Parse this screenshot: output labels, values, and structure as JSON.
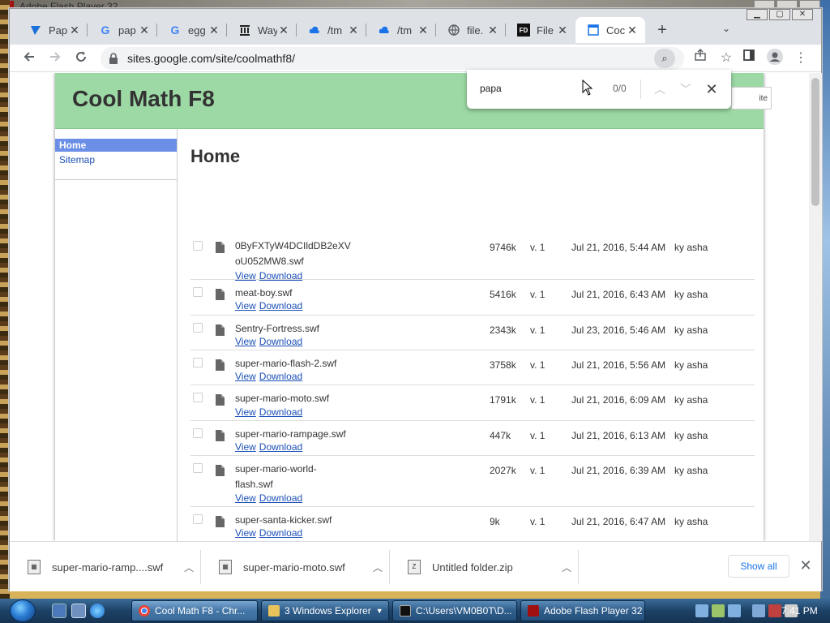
{
  "desktop": {
    "flash_title": "Adobe Flash Player 32"
  },
  "tabs": [
    {
      "label": "Pap",
      "icon": "puffin-icon",
      "active": false
    },
    {
      "label": "pap",
      "icon": "google-icon",
      "active": false
    },
    {
      "label": "egg",
      "icon": "google-icon",
      "active": false
    },
    {
      "label": "Way",
      "icon": "archive-icon",
      "active": false
    },
    {
      "label": "/tm",
      "icon": "cloud-icon",
      "active": false
    },
    {
      "label": "/tm",
      "icon": "cloud-icon",
      "active": false
    },
    {
      "label": "file.",
      "icon": "globe-icon",
      "active": false
    },
    {
      "label": "File",
      "icon": "fd-icon",
      "active": false
    },
    {
      "label": "Coc",
      "icon": "page-icon",
      "active": true
    }
  ],
  "toolbar": {
    "url": "sites.google.com/site/coolmathf8/"
  },
  "findbar": {
    "query": "papa",
    "count": "0/0"
  },
  "site": {
    "title": "Cool Math F8",
    "edit_label": "ite",
    "nav": {
      "home": "Home",
      "sitemap": "Sitemap"
    },
    "page_title": "Home",
    "view_label": "View",
    "download_label": "Download",
    "files": [
      {
        "name": "0ByFXTyW4DCIldDB2eXV oU052MW8.swf",
        "size": "9746k",
        "version": "v. 1",
        "date": "Jul 21, 2016, 5:44 AM",
        "user": "ky asha"
      },
      {
        "name": "meat-boy.swf",
        "size": "5416k",
        "version": "v. 1",
        "date": "Jul 21, 2016, 6:43 AM",
        "user": "ky asha"
      },
      {
        "name": "Sentry-Fortress.swf",
        "size": "2343k",
        "version": "v. 1",
        "date": "Jul 23, 2016, 5:46 AM",
        "user": "ky asha"
      },
      {
        "name": "super-mario-flash-2.swf",
        "size": "3758k",
        "version": "v. 1",
        "date": "Jul 21, 2016, 5:56 AM",
        "user": "ky asha"
      },
      {
        "name": "super-mario-moto.swf",
        "size": "1791k",
        "version": "v. 1",
        "date": "Jul 21, 2016, 6:09 AM",
        "user": "ky asha"
      },
      {
        "name": "super-mario-rampage.swf",
        "size": "447k",
        "version": "v. 1",
        "date": "Jul 21, 2016, 6:13 AM",
        "user": "ky asha"
      },
      {
        "name": "super-mario-world- flash.swf",
        "size": "2027k",
        "version": "v. 1",
        "date": "Jul 21, 2016, 6:39 AM",
        "user": "ky asha"
      },
      {
        "name": "super-santa-kicker.swf",
        "size": "9k",
        "version": "v. 1",
        "date": "Jul 21, 2016, 6:47 AM",
        "user": "ky asha"
      }
    ]
  },
  "downloads": {
    "items": [
      {
        "name": "super-mario-ramp....swf",
        "icon": "swf-file-icon"
      },
      {
        "name": "super-mario-moto.swf",
        "icon": "swf-file-icon"
      },
      {
        "name": "Untitled folder.zip",
        "icon": "zip-file-icon"
      }
    ],
    "show_all": "Show all"
  },
  "taskbar": {
    "buttons": [
      {
        "label": "Cool Math F8 - Chr...",
        "icon": "chrome-icon",
        "active": true
      },
      {
        "label": "3 Windows Explorer",
        "icon": "folder-icon",
        "active": false
      },
      {
        "label": "C:\\Users\\VM0B0T\\D...",
        "icon": "cmd-icon",
        "active": false
      },
      {
        "label": "Adobe Flash Player 32",
        "icon": "flash-icon",
        "active": false
      }
    ],
    "clock": "7:41 PM"
  },
  "colors": {
    "header_green": "#9dd9a5",
    "nav_active": "#6b8ee6",
    "link": "#1a4fb5"
  }
}
